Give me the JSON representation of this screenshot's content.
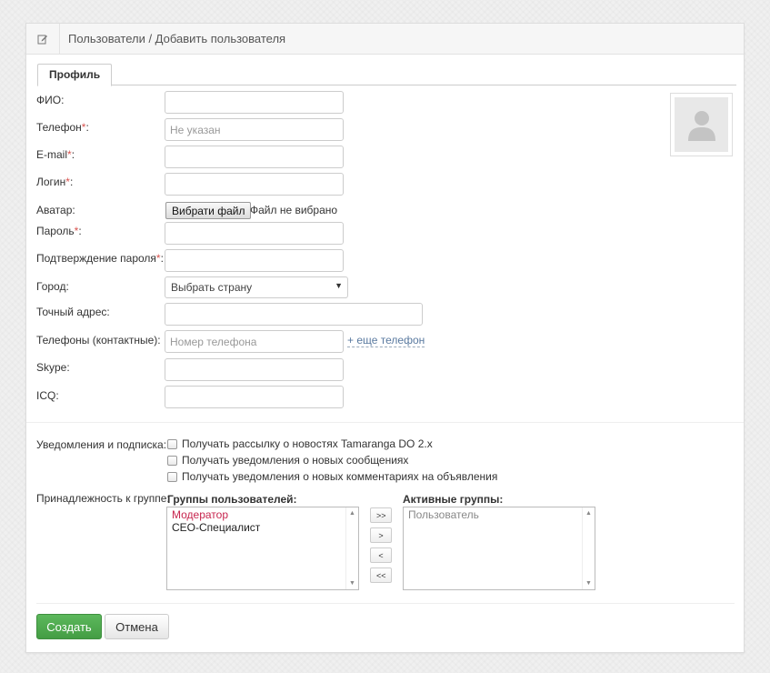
{
  "header": {
    "breadcrumb": "Пользователи / Добавить пользователя",
    "icon": "edit-icon"
  },
  "tabs": [
    {
      "label": "Профиль",
      "active": true
    }
  ],
  "form": {
    "fio_label": "ФИО:",
    "phone_label": "Телефон",
    "phone_placeholder": "Не указан",
    "email_label": "E-mail",
    "login_label": "Логин",
    "required_mark": "*",
    "colon": ":",
    "avatar_label": "Аватар:",
    "file_button": "Вибрати файл",
    "file_status": "Файл не вибрано",
    "password_label": "Пароль",
    "password_confirm_label": "Подтверждение пароля",
    "city_label": "Город:",
    "city_select_value": "Выбрать страну",
    "address_label": "Точный адрес:",
    "contact_phones_label": "Телефоны (контактные):",
    "contact_phone_placeholder": "Номер телефона",
    "add_phone_link": "+ еще телефон",
    "skype_label": "Skype:",
    "icq_label": "ICQ:"
  },
  "notifications": {
    "label": "Уведомления и подписка:",
    "options": [
      "Получать рассылку о новостях Tamaranga DO 2.x",
      "Получать уведомления о новых сообщениях",
      "Получать уведомления о новых комментариях на объявления"
    ]
  },
  "groups": {
    "label": "Принадлежность к группе:",
    "available_title": "Группы пользователей:",
    "available": [
      "Модератор",
      "СЕО-Специалист"
    ],
    "active_title": "Активные группы:",
    "active": [
      "Пользователь"
    ],
    "move_buttons": [
      ">>",
      ">",
      "<",
      "<<"
    ]
  },
  "actions": {
    "create": "Создать",
    "cancel": "Отмена"
  },
  "colors": {
    "accent_green": "#5cb85c",
    "required_red": "#d9534f",
    "moderator_red": "#c7254e",
    "link_blue": "#5a7aa0"
  }
}
